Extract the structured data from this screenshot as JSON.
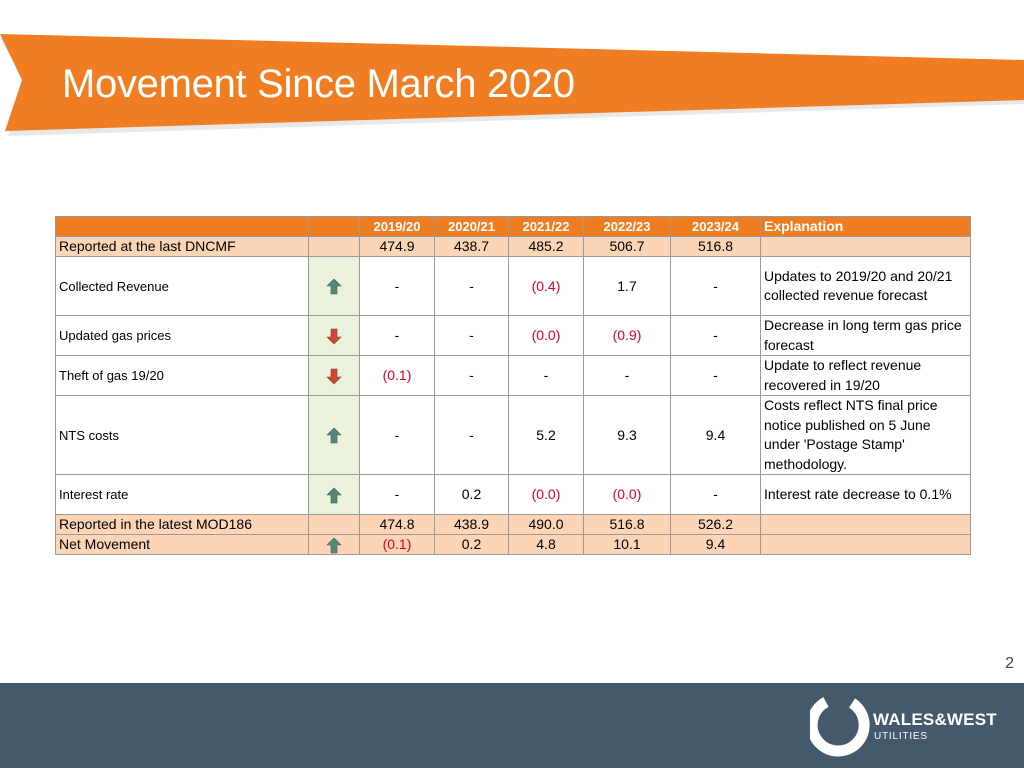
{
  "title": "Movement Since March 2020",
  "page_number": "2",
  "colors": {
    "banner": "#f07d22",
    "header_row": "#ee7d22",
    "peach_row": "#fbd5b5",
    "arrow_column": "#eaf1dd",
    "negative": "#e0001b",
    "footer": "#44596b",
    "arrow_up": "#4d8c7a",
    "arrow_down": "#d9452a"
  },
  "table": {
    "headers": [
      "",
      "",
      "2019/20",
      "2020/21",
      "2021/22",
      "2022/23",
      "2023/24",
      "Explanation"
    ],
    "reported_last": {
      "label": "Reported at the last DNCMF",
      "values": [
        "474.9",
        "438.7",
        "485.2",
        "506.7",
        "516.8"
      ],
      "explanation": ""
    },
    "rows": [
      {
        "label": "Collected Revenue",
        "trend": "up",
        "trend_icon": "arrow-up-icon",
        "values": [
          "-",
          "-",
          "(0.4)",
          "1.7",
          "-"
        ],
        "explanation": "Updates to 2019/20 and 20/21 collected revenue forecast"
      },
      {
        "label": "Updated gas prices",
        "trend": "down",
        "trend_icon": "arrow-down-icon",
        "values": [
          "-",
          "-",
          "(0.0)",
          "(0.9)",
          "-"
        ],
        "explanation": "Decrease in long term gas price forecast"
      },
      {
        "label": "Theft of gas 19/20",
        "trend": "down",
        "trend_icon": "arrow-down-icon",
        "values": [
          "(0.1)",
          "-",
          "-",
          "-",
          "-"
        ],
        "explanation": "Update to reflect revenue recovered in 19/20"
      },
      {
        "label": "NTS costs",
        "trend": "up",
        "trend_icon": "arrow-up-icon",
        "values": [
          "-",
          "-",
          "5.2",
          "9.3",
          "9.4"
        ],
        "explanation": "Costs reflect NTS final price notice published on 5 June under 'Postage Stamp' methodology."
      },
      {
        "label": "Interest rate",
        "trend": "up",
        "trend_icon": "arrow-up-icon",
        "values": [
          "-",
          "0.2",
          "(0.0)",
          "(0.0)",
          "-"
        ],
        "explanation": "Interest rate decrease to 0.1%"
      }
    ],
    "reported_latest": {
      "label": "Reported in the latest MOD186",
      "values": [
        "474.8",
        "438.9",
        "490.0",
        "516.8",
        "526.2"
      ],
      "explanation": ""
    },
    "net_movement": {
      "label": "Net Movement",
      "trend": "up",
      "trend_icon": "arrow-up-icon",
      "values": [
        "(0.1)",
        "0.2",
        "4.8",
        "10.1",
        "9.4"
      ],
      "explanation": ""
    }
  },
  "logo": {
    "name": "WALES&WEST",
    "subtitle": "UTILITIES"
  }
}
